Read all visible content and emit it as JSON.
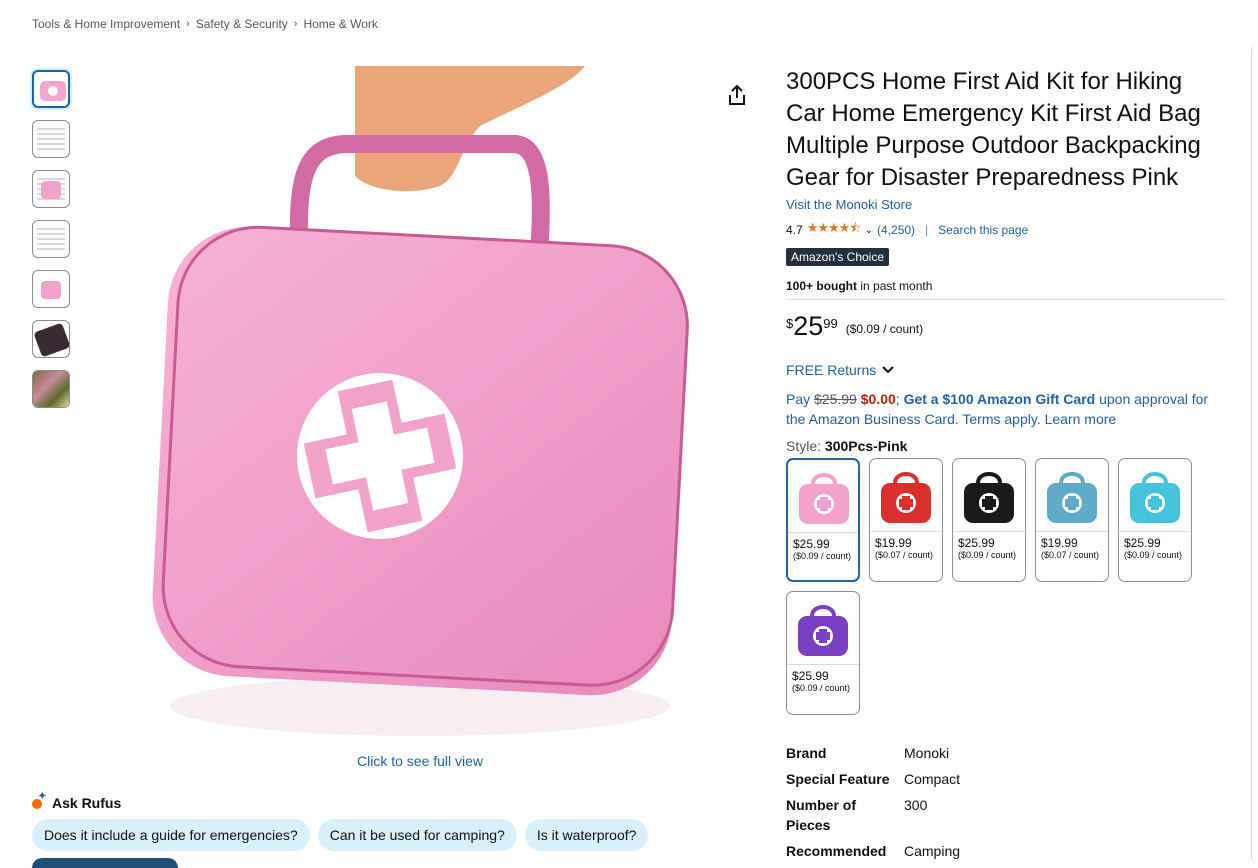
{
  "breadcrumb": [
    "Tools & Home Improvement",
    "Safety & Security",
    "Home & Work"
  ],
  "breadcrumb_sep": "›",
  "image": {
    "click_label": "Click to see full view"
  },
  "rufus": {
    "title": "Ask Rufus",
    "chips": [
      "Does it include a guide for emergencies?",
      "Can it be used for camping?",
      "Is it waterproof?"
    ]
  },
  "product": {
    "title": "300PCS Home First Aid Kit for Hiking Car Home Emergency Kit First Aid Bag Multiple Purpose Outdoor Backpacking Gear for Disaster Preparedness Pink",
    "store": "Visit the Monoki Store",
    "rating": "4.7",
    "stars": "★★★★⯪",
    "rating_count": "(4,250)",
    "search_page": "Search this page",
    "badge": "Amazon's Choice",
    "bought_bold": "100+ bought",
    "bought_rest": " in past month",
    "price_symbol": "$",
    "price_whole": "25",
    "price_fraction": "99",
    "price_unit": "($0.09 / count)",
    "returns": "FREE Returns",
    "pay": {
      "pay": "Pay ",
      "old": "$25.99",
      "new": "$0.00",
      "semi": "; ",
      "gift": "Get a $100 Amazon Gift Card",
      "rest": " upon approval for the Amazon Business Card. Terms apply. ",
      "learn": "Learn more"
    },
    "style_label": "Style: ",
    "style_value": "300Pcs-Pink",
    "swatches": [
      {
        "price": "$25.99",
        "unit": "($0.09 / count)",
        "color": "#f2a2ca"
      },
      {
        "price": "$19.99",
        "unit": "($0.07 / count)",
        "color": "#d9302d"
      },
      {
        "price": "$25.99",
        "unit": "($0.09 / count)",
        "color": "#1a1a1a"
      },
      {
        "price": "$19.99",
        "unit": "($0.07 / count)",
        "color": "#5fa9c9"
      },
      {
        "price": "$25.99",
        "unit": "($0.09 / count)",
        "color": "#45c2dc"
      },
      {
        "price": "$25.99",
        "unit": "($0.09 / count)",
        "color": "#7a3fc4"
      }
    ],
    "specs": [
      {
        "key": "Brand",
        "value": "Monoki"
      },
      {
        "key": "Special Feature",
        "value": "Compact"
      },
      {
        "key": "Number of Pieces",
        "value": "300"
      },
      {
        "key": "Recommended",
        "value": "Camping"
      }
    ]
  },
  "colors": {
    "link": "#2162a1",
    "accent": "#de7921",
    "badge": "#232f3e",
    "bag": "#f2a2ca"
  }
}
